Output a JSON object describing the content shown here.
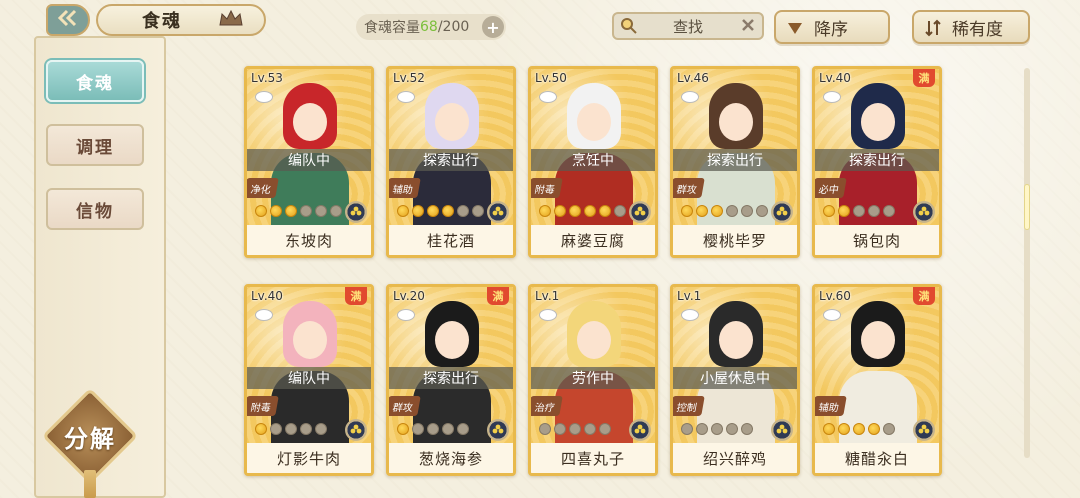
{
  "header": {
    "back_icon": "double-chevron-left-icon",
    "title": "食魂",
    "crown_icon": "crown-icon",
    "capacity_label": "食魂容量",
    "capacity_current": "68",
    "capacity_max": "/200",
    "capacity_add": "+",
    "search_placeholder": "查找",
    "sort_desc_label": "降序",
    "sort_rarity_label": "稀有度"
  },
  "sidebar": {
    "tabs": [
      {
        "label": "食魂",
        "active": true
      },
      {
        "label": "调理",
        "active": false
      },
      {
        "label": "信物",
        "active": false
      }
    ],
    "decompose_label": "分解"
  },
  "cards": [
    {
      "level": "Lv.53",
      "full": false,
      "status": "编队中",
      "role": "净化",
      "stars_on": 3,
      "stars_total": 6,
      "name": "东坡肉",
      "hair": "#c8262a",
      "outfit": "#3f7c5a"
    },
    {
      "level": "Lv.52",
      "full": false,
      "status": "探索出行",
      "role": "辅助",
      "stars_on": 4,
      "stars_total": 6,
      "name": "桂花酒",
      "hair": "#dfd8f0",
      "outfit": "#2b2b3a"
    },
    {
      "level": "Lv.50",
      "full": false,
      "status": "烹饪中",
      "role": "附毒",
      "stars_on": 5,
      "stars_total": 6,
      "name": "麻婆豆腐",
      "hair": "#f2f2f2",
      "outfit": "#b02d22"
    },
    {
      "level": "Lv.46",
      "full": false,
      "status": "探索出行",
      "role": "群攻",
      "stars_on": 3,
      "stars_total": 6,
      "name": "樱桃毕罗",
      "hair": "#5a3c2a",
      "outfit": "#d9e0d0"
    },
    {
      "level": "Lv.40",
      "full": true,
      "full_label": "满",
      "status": "探索出行",
      "role": "必中",
      "stars_on": 2,
      "stars_total": 5,
      "name": "锅包肉",
      "hair": "#1f2a4a",
      "outfit": "#a8202a"
    },
    {
      "level": "Lv.40",
      "full": true,
      "full_label": "满",
      "status": "编队中",
      "role": "附毒",
      "stars_on": 1,
      "stars_total": 5,
      "name": "灯影牛肉",
      "hair": "#f3b3bd",
      "outfit": "#2a2a2a"
    },
    {
      "level": "Lv.20",
      "full": true,
      "full_label": "满",
      "status": "探索出行",
      "role": "群攻",
      "stars_on": 1,
      "stars_total": 5,
      "name": "葱烧海参",
      "hair": "#1b1b1b",
      "outfit": "#2b2b2b"
    },
    {
      "level": "Lv.1",
      "full": false,
      "status": "劳作中",
      "role": "治疗",
      "stars_on": 0,
      "stars_total": 5,
      "name": "四喜丸子",
      "hair": "#f3d67a",
      "outfit": "#c5462d"
    },
    {
      "level": "Lv.1",
      "full": false,
      "status": "小屋休息中",
      "role": "控制",
      "stars_on": 0,
      "stars_total": 5,
      "name": "绍兴醉鸡",
      "hair": "#2a2a2a",
      "outfit": "#ede6d6"
    },
    {
      "level": "Lv.60",
      "full": true,
      "full_label": "满",
      "status": "",
      "role": "辅助",
      "stars_on": 4,
      "stars_total": 5,
      "name": "糖醋汆白",
      "hair": "#1b1b1b",
      "outfit": "#f0ece0"
    }
  ]
}
